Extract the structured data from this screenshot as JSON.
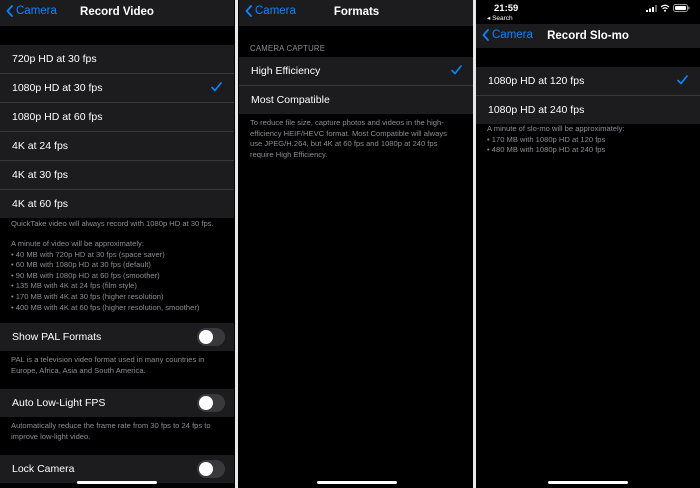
{
  "colors": {
    "accent": "#0a84ff",
    "cell": "#1c1c1e",
    "footnote": "#8d8d93",
    "toggle_off": "#39393d"
  },
  "left_panel": {
    "back_label": "Camera",
    "title": "Record Video",
    "options": [
      {
        "label": "720p HD at 30 fps",
        "selected": false
      },
      {
        "label": "1080p HD at 30 fps",
        "selected": true
      },
      {
        "label": "1080p HD at 60 fps",
        "selected": false
      },
      {
        "label": "4K at 24 fps",
        "selected": false
      },
      {
        "label": "4K at 30 fps",
        "selected": false
      },
      {
        "label": "4K at 60 fps",
        "selected": false
      }
    ],
    "quicktake_note": "QuickTake video will always record with 1080p HD at 30 fps.",
    "size_intro": "A minute of video will be approximately:",
    "size_lines": [
      "• 40 MB with 720p HD at 30 fps (space saver)",
      "• 60 MB with 1080p HD at 30 fps (default)",
      "• 90 MB with 1080p HD at 60 fps (smoother)",
      "• 135 MB with 4K at 24 fps (film style)",
      "• 170 MB with 4K at 30 fps (higher resolution)",
      "• 400 MB with 4K at 60 fps (higher resolution, smoother)"
    ],
    "pal_label": "Show PAL Formats",
    "pal_on": false,
    "pal_note_1": "PAL is a television video format used in many countries in",
    "pal_note_2": "Europe, Africa, Asia and South America.",
    "lowlight_label": "Auto Low-Light FPS",
    "lowlight_on": false,
    "lowlight_note_1": "Automatically reduce the frame rate from 30 fps to 24 fps to",
    "lowlight_note_2": "improve low-light video.",
    "lock_label": "Lock Camera",
    "lock_on": false
  },
  "middle_panel": {
    "back_label": "Camera",
    "title": "Formats",
    "section_header": "CAMERA CAPTURE",
    "options": [
      {
        "label": "High Efficiency",
        "selected": true
      },
      {
        "label": "Most Compatible",
        "selected": false
      }
    ],
    "note_lines": [
      "To reduce file size, capture photos and videos in the high-",
      "efficiency HEIF/HEVC format. Most Compatible will always",
      "use JPEG/H.264, but 4K at 60 fps and 1080p at 240 fps",
      "require High Efficiency."
    ]
  },
  "right_panel": {
    "status_time": "21:59",
    "status_back": "◂ Search",
    "back_label": "Camera",
    "title": "Record Slo-mo",
    "options": [
      {
        "label": "1080p HD at 120 fps",
        "selected": true
      },
      {
        "label": "1080p HD at 240 fps",
        "selected": false
      }
    ],
    "size_intro": "A minute of slo-mo will be approximately:",
    "size_lines": [
      "• 170 MB with 1080p HD at 120 fps",
      "• 480 MB with 1080p HD at 240 fps"
    ]
  }
}
